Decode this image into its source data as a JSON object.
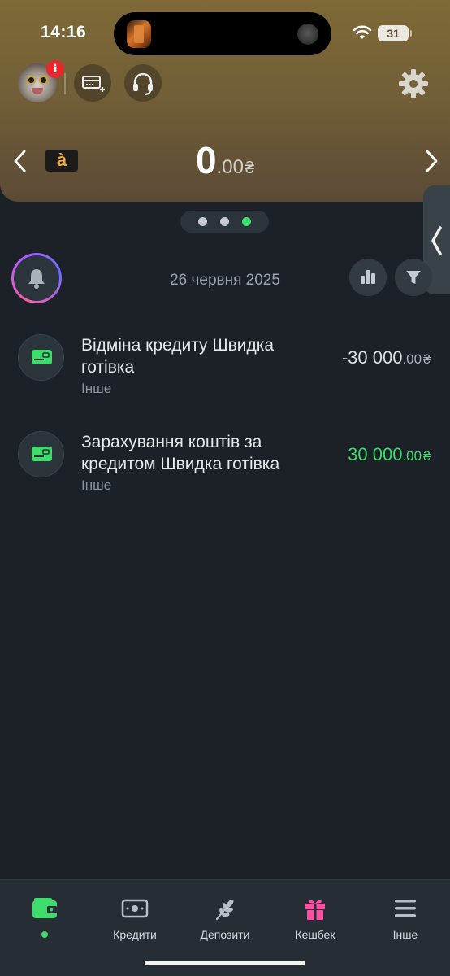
{
  "status_bar": {
    "time": "14:16",
    "battery": "31"
  },
  "header": {
    "notification_badge": "i",
    "currency_chip": "à",
    "balance": {
      "integer": "0",
      "decimal": ".00",
      "currency": "₴"
    },
    "page_count": 3,
    "active_page": 3
  },
  "feed": {
    "date": "26 червня 2025",
    "transactions": [
      {
        "title": "Відміна кредиту Швидка готівка",
        "category": "Інше",
        "amount_int": "-30 000",
        "amount_dec": ".00",
        "currency": "₴",
        "direction": "negative"
      },
      {
        "title": "Зарахування коштів за кредитом Швидка готівка",
        "category": "Інше",
        "amount_int": "30 000",
        "amount_dec": ".00",
        "currency": "₴",
        "direction": "positive"
      }
    ]
  },
  "tabs": [
    {
      "label": "",
      "icon": "wallet-icon",
      "active": true
    },
    {
      "label": "Кредити",
      "icon": "banknote-icon",
      "active": false
    },
    {
      "label": "Депозити",
      "icon": "wheat-icon",
      "active": false
    },
    {
      "label": "Кешбек",
      "icon": "gift-icon",
      "active": false
    },
    {
      "label": "Інше",
      "icon": "menu-icon",
      "active": false
    }
  ],
  "colors": {
    "background": "#1b2127",
    "header_gold": "#7e6a36",
    "accent_green": "#3ddc6b",
    "badge_red": "#e8262b",
    "cashback_pink": "#ff4fa3",
    "currency_orange": "#f2a93b"
  }
}
